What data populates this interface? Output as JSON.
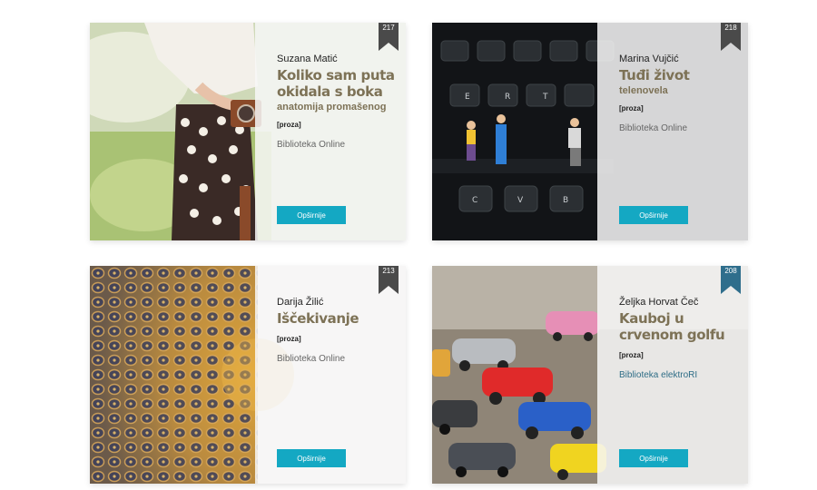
{
  "colors": {
    "accent": "#14a8c3",
    "title": "#7d7256",
    "ribbon": "#4a4a4a",
    "ribbon_blue": "#2f6e8c"
  },
  "cards": [
    {
      "number": "217",
      "author": "Suzana Matić",
      "title": "Koliko sam puta okidala s boka",
      "subtitle": "anatomija promašenog",
      "genre": "[proza]",
      "library": "Biblioteka Online",
      "button": "Opširnije",
      "ribbon_color": "dark",
      "icon": "photo-woman-camera-icon"
    },
    {
      "number": "218",
      "author": "Marina Vujčić",
      "title": "Tuđi život",
      "subtitle": "telenovela",
      "genre": "[proza]",
      "library": "Biblioteka Online",
      "button": "Opširnije",
      "ribbon_color": "dark",
      "icon": "photo-typewriter-figures-icon"
    },
    {
      "number": "213",
      "author": "Darija Žilić",
      "title": "Iščekivanje",
      "genre": "[proza]",
      "library": "Biblioteka Online",
      "button": "Opširnije",
      "ribbon_color": "dark",
      "icon": "photo-mosaic-dome-icon"
    },
    {
      "number": "208",
      "author": "Željka Horvat Čeč",
      "title": "Kauboj u crvenom golfu",
      "genre": "[proza]",
      "library": "Biblioteka elektroRI",
      "button": "Opširnije",
      "ribbon_color": "blue",
      "icon": "photo-toy-cars-icon"
    }
  ]
}
